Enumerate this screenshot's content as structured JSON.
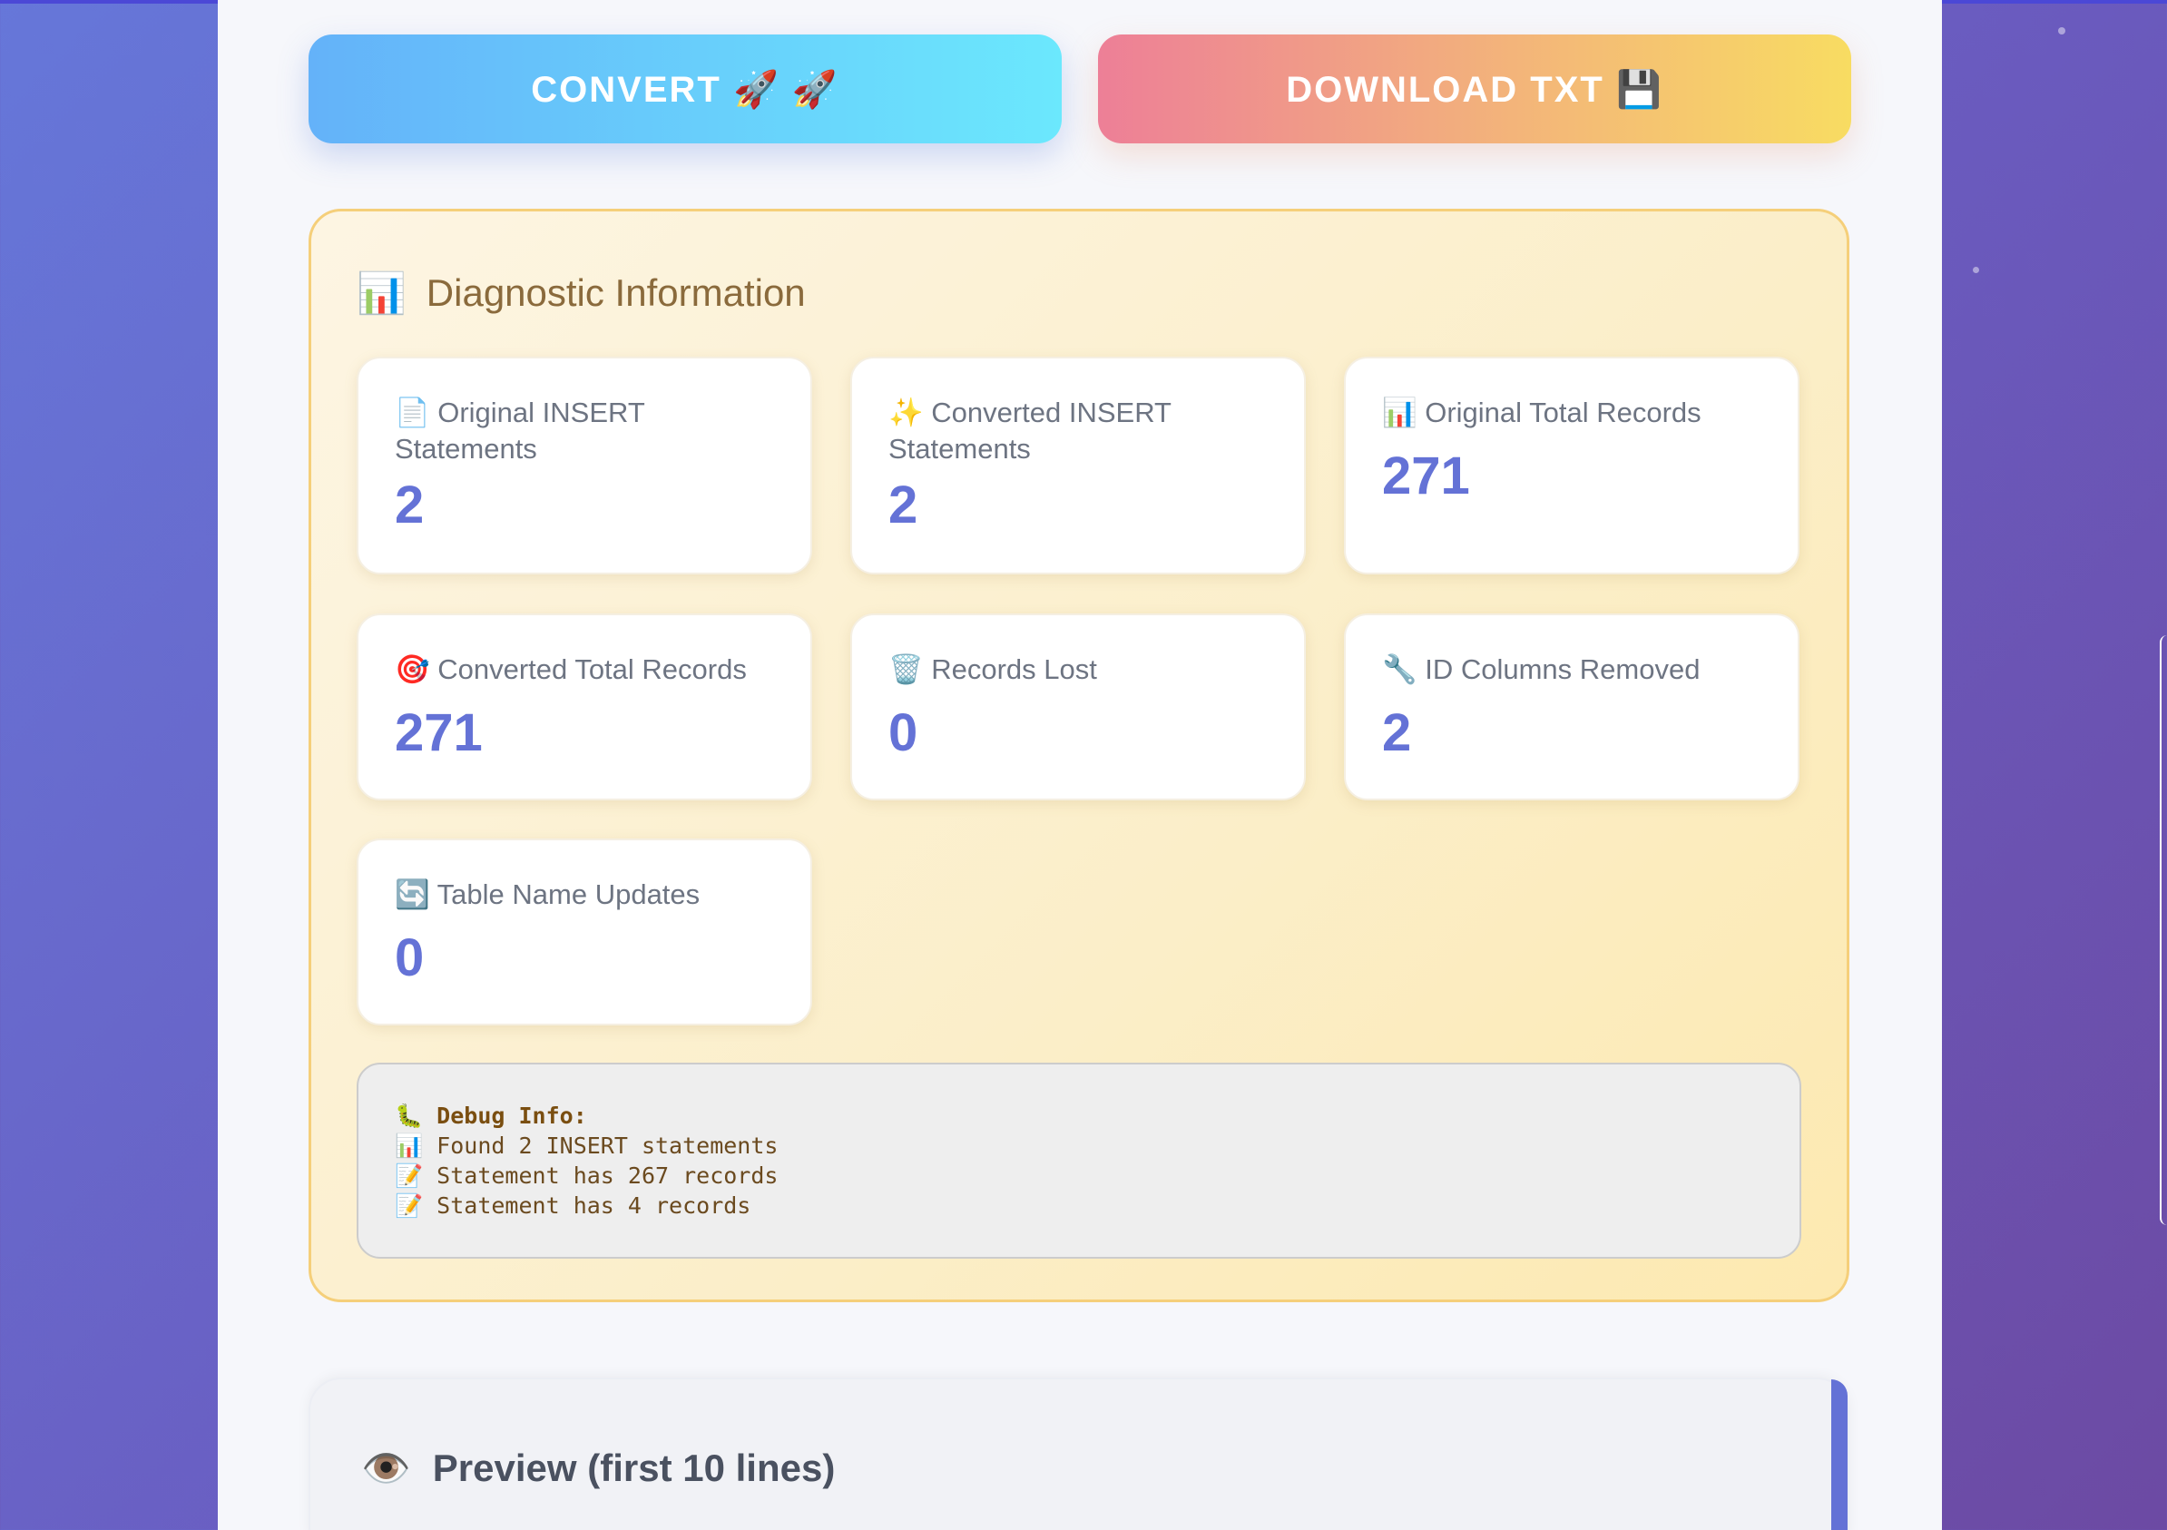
{
  "buttons": {
    "convert_label": "CONVERT 🚀 🚀",
    "download_label": "DOWNLOAD TXT 💾"
  },
  "diagnostic": {
    "icon": "📊",
    "title": "Diagnostic Information",
    "cards": [
      {
        "icon": "📄",
        "label": "Original INSERT Statements",
        "value": "2"
      },
      {
        "icon": "✨",
        "label": "Converted INSERT Statements",
        "value": "2"
      },
      {
        "icon": "📊",
        "label": "Original Total Records",
        "value": "271"
      },
      {
        "icon": "🎯",
        "label": "Converted Total Records",
        "value": "271"
      },
      {
        "icon": "🗑️",
        "label": "Records Lost",
        "value": "0"
      },
      {
        "icon": "🔧",
        "label": "ID Columns Removed",
        "value": "2"
      },
      {
        "icon": "🔄",
        "label": "Table Name Updates",
        "value": "0"
      }
    ],
    "debug": {
      "heading": "🐛 Debug Info:",
      "lines": [
        "📊 Found 2 INSERT statements",
        "📝 Statement has 267 records",
        "📝 Statement has 4 records"
      ]
    }
  },
  "preview": {
    "icon": "👁️",
    "title": "Preview (first 10 lines)"
  },
  "colors": {
    "accent": "#6472d6",
    "diag_border": "#f5cf7a",
    "diag_title": "#8a6a3c"
  }
}
